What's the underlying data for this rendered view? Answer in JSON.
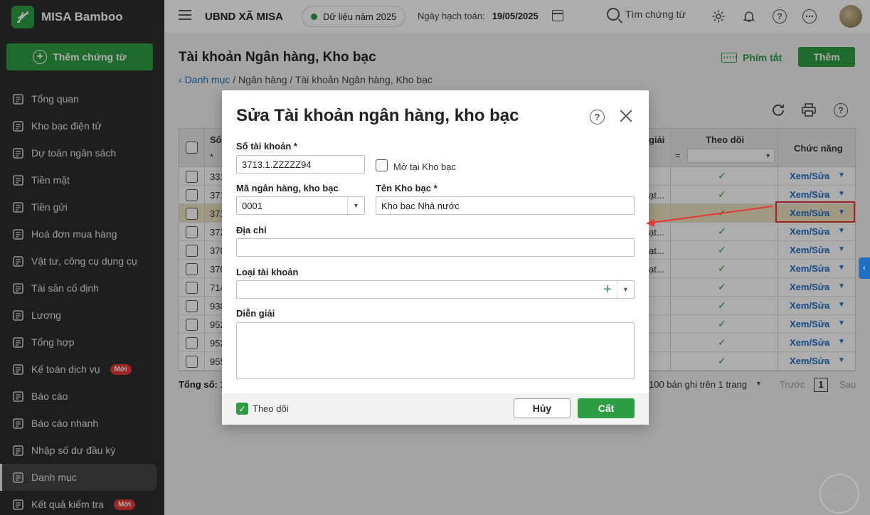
{
  "app": {
    "brand": "MISA Bamboo",
    "add_voucher": "Thêm chứng từ"
  },
  "sidebar": {
    "items": [
      {
        "label": "Tổng quan",
        "icon": "pie-chart-icon"
      },
      {
        "label": "Kho bạc điện tử",
        "icon": "monitor-icon"
      },
      {
        "label": "Dự toán ngân sách",
        "icon": "budget-icon"
      },
      {
        "label": "Tiền mặt",
        "icon": "cash-icon"
      },
      {
        "label": "Tiền gửi",
        "icon": "deposit-icon"
      },
      {
        "label": "Hoá đơn mua hàng",
        "icon": "invoice-icon"
      },
      {
        "label": "Vật tư, công cụ dụng cụ",
        "icon": "tools-icon"
      },
      {
        "label": "Tài sản cố định",
        "icon": "bank-building-icon"
      },
      {
        "label": "Lương",
        "icon": "salary-icon"
      },
      {
        "label": "Tổng hợp",
        "icon": "summary-icon"
      },
      {
        "label": "Kế toán dịch vụ",
        "icon": "service-icon",
        "badge": "Mới"
      },
      {
        "label": "Báo cáo",
        "icon": "report-icon"
      },
      {
        "label": "Báo cáo nhanh",
        "icon": "quick-report-icon"
      },
      {
        "label": "Nhập số dư đầu kỳ",
        "icon": "opening-balance-icon"
      },
      {
        "label": "Danh mục",
        "icon": "catalog-icon",
        "active": true
      },
      {
        "label": "Kết quả kiểm tra",
        "icon": "check-result-icon",
        "badge": "Mới"
      }
    ]
  },
  "topbar": {
    "org": "UBND XÃ MISA",
    "year": "Dữ liệu năm 2025",
    "post_date_label": "Ngày hạch toán:",
    "post_date_value": "19/05/2025",
    "search_label": "Tìm chứng từ"
  },
  "page": {
    "title": "Tài khoản Ngân hàng, Kho bạc",
    "breadcrumb_link": "Danh mục",
    "breadcrumb_rest": " / Ngân hàng / Tài khoản Ngân hàng, Kho bạc",
    "shortcut": "Phím tắt",
    "add": "Thêm"
  },
  "table": {
    "col_number": "Số",
    "col_desc": "giải",
    "col_track": "Theo dõi",
    "col_action": "Chức năng",
    "filter_star": "*",
    "filter_eq": "=",
    "action_label": "Xem/Sửa",
    "rows": [
      {
        "no": "331",
        "desc": "",
        "tracked": "✓"
      },
      {
        "no": "371",
        "desc": "ạt...",
        "tracked": "✓"
      },
      {
        "no": "371",
        "desc": "",
        "tracked": "✓",
        "selected": true
      },
      {
        "no": "372",
        "desc": "ạt...",
        "tracked": "✓"
      },
      {
        "no": "370",
        "desc": "ạt...",
        "tracked": "✓"
      },
      {
        "no": "370",
        "desc": "ạt...",
        "tracked": "✓"
      },
      {
        "no": "714",
        "desc": "",
        "tracked": "✓"
      },
      {
        "no": "930",
        "desc": "",
        "tracked": "✓"
      },
      {
        "no": "952",
        "desc": "",
        "tracked": "✓"
      },
      {
        "no": "952",
        "desc": "",
        "tracked": "✓"
      },
      {
        "no": "955",
        "desc": "",
        "tracked": "✓"
      }
    ],
    "total_label": "Tổng số: 1",
    "paging_text": "100 bản ghi trên 1 trang",
    "prev": "Trước",
    "page_no": "1",
    "next": "Sau"
  },
  "modal": {
    "title": "Sửa Tài khoản ngân hàng, kho bạc",
    "account_no_label": "Số tài khoản *",
    "account_no_value": "3713.1.ZZZZZ94",
    "open_at_treasury": "Mở tại Kho bạc",
    "bank_code_label": "Mã ngân hàng, kho bạc",
    "bank_code_value": "0001",
    "treasury_name_label": "Tên Kho bạc *",
    "treasury_name_value": "Kho bạc Nhà nước",
    "address_label": "Địa chỉ",
    "address_value": "",
    "account_type_label": "Loại tài khoản",
    "account_type_value": "",
    "description_label": "Diễn giải",
    "description_value": "",
    "track_label": "Theo dõi",
    "cancel": "Hủy",
    "save": "Cất"
  },
  "stamp": "DỮ LIỆU MẪU",
  "colors": {
    "brand_green": "#2e9e44",
    "link_blue": "#1f6fc5",
    "highlight_red": "#e53935"
  }
}
